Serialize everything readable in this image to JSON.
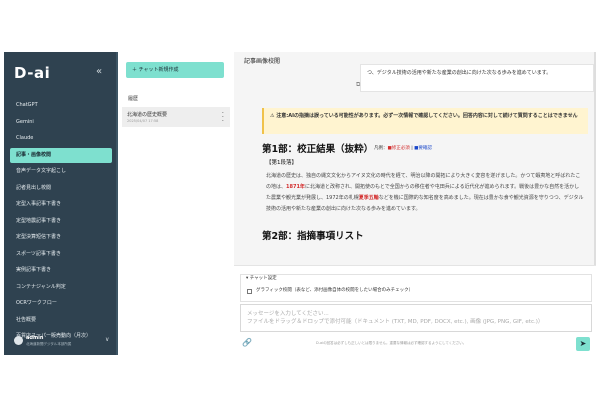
{
  "sidebar": {
    "logo": "D-ai",
    "collapse_icon": "«",
    "items": [
      {
        "label": "ChatGPT"
      },
      {
        "label": "Gemini"
      },
      {
        "label": "Claude"
      },
      {
        "label": "記事・画像校閲"
      },
      {
        "label": "音声データ文字起こし"
      },
      {
        "label": "記者見出し校閲"
      },
      {
        "label": "定型入事記事下書き"
      },
      {
        "label": "定型地震記事下書き"
      },
      {
        "label": "定型決算短信下書き"
      },
      {
        "label": "スポーツ記事下書き"
      },
      {
        "label": "実例記事下書き"
      },
      {
        "label": "コンテナジャンル判定"
      },
      {
        "label": "OCRワークフロー"
      },
      {
        "label": "社告概要"
      },
      {
        "label": "百貨店スーパー販売動向（月次）"
      }
    ],
    "active_index": 3,
    "user": {
      "name": "admin",
      "sub": "北海道新聞デジタル本部所属"
    }
  },
  "chat_list": {
    "new_chat_label": "＋ チャット新規作成",
    "history_label": "履歴",
    "items": [
      {
        "title": "北海道の歴史概要",
        "date": "2025/04/07 17:58"
      }
    ]
  },
  "main": {
    "title": "記事画像校閲",
    "ai_message_tail": "つ、デジタル技術の活用や新たな産業の創出に向けた次なる歩みを進めています。",
    "warning": "⚠ 注意:AIの指摘は誤っている可能性があります。必ず一次情報で確認してください。回答内容に対して続けて質問することはできません",
    "section1_heading": "第1部：校正結果（抜粋）",
    "legend": {
      "prefix": "凡例：",
      "red_label": "■修正必須",
      "sep": " | ",
      "blue_label": "■要確認"
    },
    "para_head": "【第1段落】",
    "paragraph": {
      "before": "北海道の歴史は、独自の縄文文化からアイヌ文化の時代を経て、明治以降の開拓により大きく変容を遂げました。かつて蝦夷地と呼ばれたこの地は、",
      "highlight1": "1871年",
      "middle": "に北海道と改称され、開拓使のもとで全国からの移住者や屯田兵による近代化が進められます。戦後は豊かな自然を活かした農業や観光業が発展し、1972年の札幌",
      "highlight2": "夏季五輪",
      "after": "などを機に国際的な知名度を高めました。現在は豊かな食や観光資源を守りつつ、デジタル技術の活用や新たな産業の創出に向けた次なる歩みを進めています。"
    },
    "section2_heading": "第2部：指摘事項リスト"
  },
  "input": {
    "settings_label": "▾ チャット設定",
    "checkbox_label": "グラフィック校閲（表など、添付画像自体の校閲をしたい場合のみチェック）",
    "placeholder_line1": "メッセージを入力してください...",
    "placeholder_line2": "ファイルをドラッグ＆ドロップで添付可能（ドキュメント (TXT, MD, PDF, DOCX, etc.), 画像 (JPG, PNG, GIF, etc.)）",
    "notice": "D-aiの回答は必ずしも正しいとは限りません。重要な情報は必ず確認するようにしてください。"
  },
  "colors": {
    "sidebar_bg": "#2f4250",
    "accent": "#7ee0cf",
    "warning_bg": "#fff4d0",
    "red": "#d32f2f",
    "blue": "#1a47c9"
  }
}
